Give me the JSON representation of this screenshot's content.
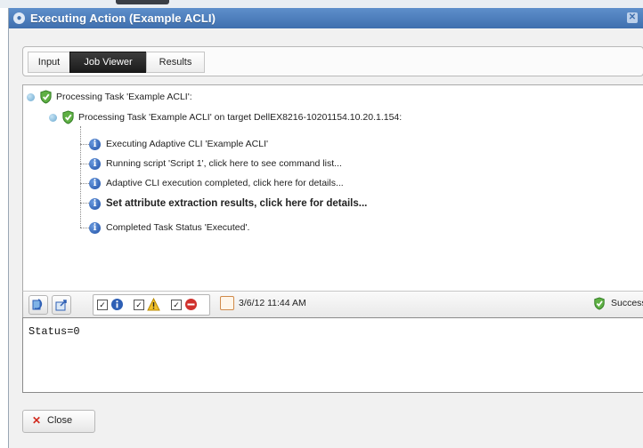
{
  "window": {
    "title": "Executing Action (Example ACLI)"
  },
  "tabs": [
    {
      "label": "Input",
      "active": false
    },
    {
      "label": "Job Viewer",
      "active": true
    },
    {
      "label": "Results",
      "active": false
    }
  ],
  "tree": {
    "root": "Processing Task 'Example ACLI':",
    "child": "Processing Task 'Example ACLI' on target DellEX8216-10201154.10.20.1.154:",
    "messages": [
      "Executing Adaptive CLI 'Example ACLI'",
      "Running script 'Script 1', click here to see command list...",
      "Adaptive CLI execution completed, click here for details...",
      "Set attribute extraction results, click here for details...",
      "Completed Task Status 'Executed'."
    ]
  },
  "toolbar": {
    "timestamp": "3/6/12 11:44 AM",
    "status": "Success",
    "filters": {
      "info": true,
      "warning": true,
      "error": true
    }
  },
  "output": {
    "text": "Status=0"
  },
  "footer": {
    "close_label": "Close"
  },
  "colors": {
    "titlebar": "#4a7cbd",
    "active_tab": "#2a2a2a",
    "success": "#4aa336",
    "info": "#2d5fb5"
  }
}
